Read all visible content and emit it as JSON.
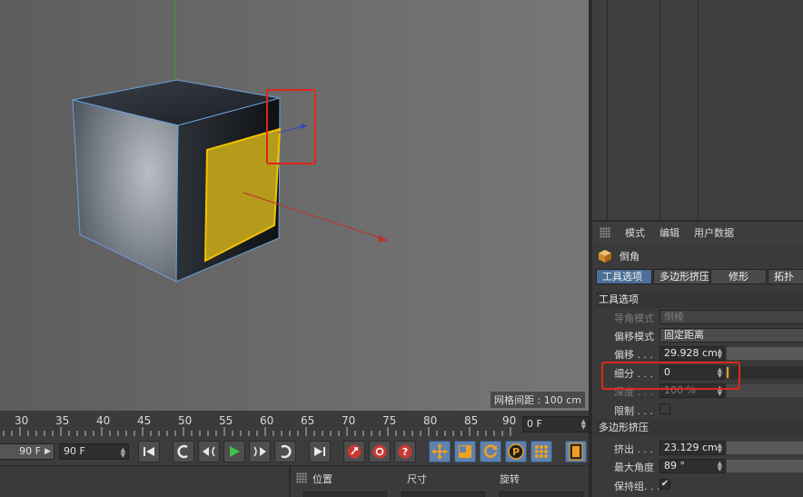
{
  "viewport": {
    "grid_spacing_label": "网格间距 : 100 cm"
  },
  "timeline": {
    "ticks": [
      "30",
      "35",
      "40",
      "45",
      "50",
      "55",
      "60",
      "65",
      "70",
      "75",
      "80",
      "85",
      "90"
    ],
    "current_frame": "0 F"
  },
  "transport": {
    "start_frame": "90 F",
    "end_frame": "90 F"
  },
  "coordinates": {
    "headers": [
      "位置",
      "尺寸",
      "旋转"
    ]
  },
  "attributes": {
    "menu": [
      "模式",
      "编辑",
      "用户数据"
    ],
    "object_title": "倒角",
    "tabs": [
      "工具选项",
      "多边形挤压",
      "修形",
      "拓扑"
    ],
    "active_tab": "工具选项",
    "section_tool": "工具选项",
    "chamfer_mode_label": "导角模式",
    "chamfer_mode_value": "倒棱",
    "offset_mode_label": "偏移模式",
    "offset_mode_value": "固定距离",
    "offset_label": "偏移 . . .",
    "offset_value": "29.928 cm",
    "subdivision_label": "细分 . . .",
    "subdivision_value": "0",
    "depth_label": "深度 . . .",
    "depth_value": "100 %",
    "limit_label": "限制 . . .",
    "section_extrude": "多边形挤压",
    "extrude_label": "挤出 . . .",
    "extrude_value": "23.129 cm",
    "max_angle_label": "最大角度",
    "max_angle_value": "89 °",
    "keep_groups_label": "保持组. . .",
    "keep_groups_checked": "✔"
  },
  "colors": {
    "accent_blue": "#5e82b0",
    "selection_yellow": "#e8b400",
    "callout_red": "#e0261b",
    "axis_x": "#c0302a",
    "axis_y": "#2fa33a",
    "axis_z": "#3340c8"
  }
}
